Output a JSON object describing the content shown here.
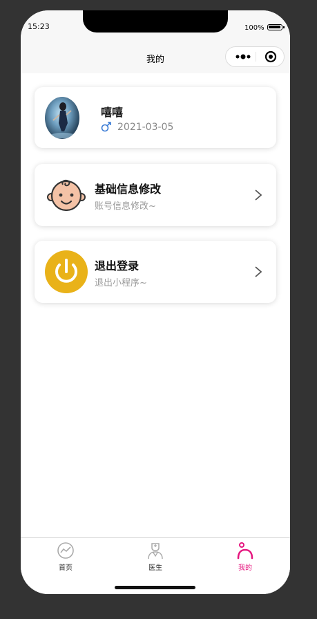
{
  "status_bar": {
    "time": "15:23",
    "battery": "100%"
  },
  "nav": {
    "title": "我的",
    "more_icon": "more-dots-icon",
    "close_icon": "target-circle-icon"
  },
  "profile": {
    "name": "嘻嘻",
    "gender_icon": "male-icon",
    "birthday": "2021-03-05"
  },
  "menu": [
    {
      "title": "基础信息修改",
      "subtitle": "账号信息修改~",
      "icon": "baby-face-icon"
    },
    {
      "title": "退出登录",
      "subtitle": "退出小程序~",
      "icon": "power-icon"
    }
  ],
  "tabbar": {
    "items": [
      {
        "label": "首页",
        "icon": "trend-circle-icon",
        "active": false
      },
      {
        "label": "医生",
        "icon": "doctor-icon",
        "active": false
      },
      {
        "label": "我的",
        "icon": "person-icon",
        "active": true
      }
    ],
    "active_color": "#e5177f"
  },
  "colors": {
    "logout_icon_bg": "#e9b219",
    "gender_male": "#3a7bd5"
  }
}
